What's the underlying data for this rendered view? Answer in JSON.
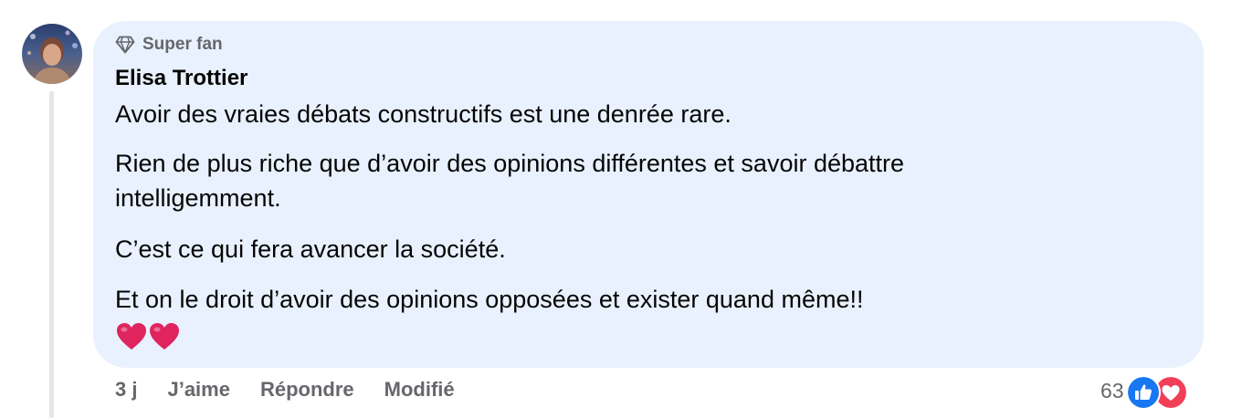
{
  "comment": {
    "badge": "Super fan",
    "author": "Elisa Trottier",
    "paragraphs": [
      "Avoir des vraies débats constructifs est une denrée rare.",
      "Rien de plus riche que d’avoir des opinions différentes et savoir débattre intelligemment.",
      "C’est ce qui fera avancer la société.",
      "Et on le droit d’avoir des opinions opposées et exister quand même!!"
    ],
    "emoji_line": "❤️❤️"
  },
  "actions": {
    "time": "3 j",
    "like_label": "J’aime",
    "reply_label": "Répondre",
    "edited_label": "Modifié"
  },
  "reactions": {
    "count": "63",
    "types": [
      "like-icon",
      "love-icon"
    ]
  },
  "colors": {
    "bubble": "#e8f1fd",
    "secondary_text": "#65676b",
    "like_blue": "#1877f2",
    "love_red": "#f33e58"
  }
}
